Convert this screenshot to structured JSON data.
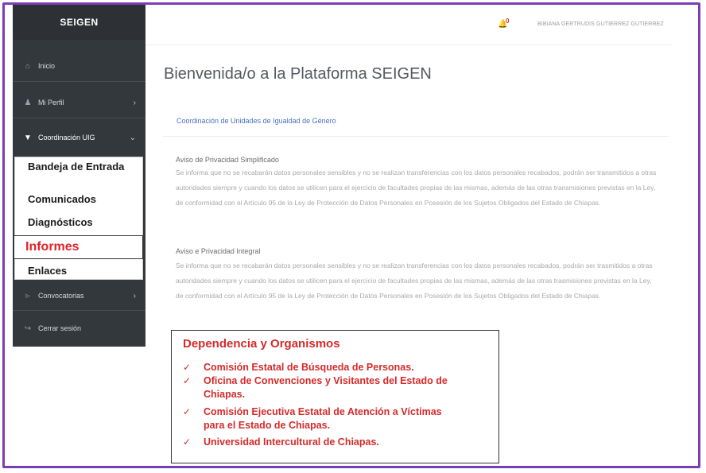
{
  "app": {
    "brand": "SEIGEN"
  },
  "sidebar": {
    "items": [
      {
        "label": "Inicio",
        "icon": "home-icon"
      },
      {
        "label": "Mi Perfil",
        "icon": "user-icon"
      },
      {
        "label": "Coordinación UIG",
        "icon": "sitemap-icon"
      },
      {
        "label": "Convocatorias",
        "icon": "megaphone-icon"
      },
      {
        "label": "Cerrar sesión",
        "icon": "logout-icon"
      }
    ],
    "submenu": [
      "Bandeja de Entrada",
      "Comunicados",
      "Diagnósticos",
      "Informes",
      "Enlaces"
    ]
  },
  "header": {
    "notification_count": "0",
    "user_name": "BIBIANA GERTRUDIS GUTIERREZ GUTIERREZ"
  },
  "main": {
    "welcome": "Bienvenida/o a la Plataforma SEIGEN",
    "coordination": "Coordinación de Unidades de Igualdad de Género",
    "privacy_simple_title": "Aviso de Privacidad Simplificado",
    "privacy_simple_text": "Se informa que no se recabarán datos personales sensibles y no se realizan transferencias con los datos personales recabados, podrán ser transmitidos a otras autoridades siempre y cuando los datos se utilicen para el ejercicio de facultades propias de las mismas, además de las otras transmisiones previstas en la Ley, de conformidad con el Artículo 95 de la Ley de Protección de Datos Personales en Posesión de los Sujetos Obligados del Estado de Chiapas.",
    "privacy_full_title": "Aviso e Privacidad Integral",
    "privacy_full_text": "Se informa que no se recabarán datos personales sensibles y no se realizan transferencias con los datos personales recabados, podrán ser trasmitidos a otras autoridades siempre y cuando los datos se utilicen para el ejercicio de facultades propias de las mismas, además de las otras trasmisiones previstas en la Ley, de conformidad con el Artículo 95 de la Ley de Protección de Datos Personales en Posesión de los Sujetos Obligados del Estado de Chiapas."
  },
  "callout": {
    "title": "Dependencia y Organismos",
    "orgs": [
      "Comisión Estatal de Búsqueda de Personas.",
      "Oficina de Convenciones y Visitantes del Estado de Chiapas.",
      "Comisión Ejecutiva Estatal de Atención a Víctimas para el Estado de Chiapas.",
      "Universidad Intercultural de Chiapas."
    ]
  }
}
